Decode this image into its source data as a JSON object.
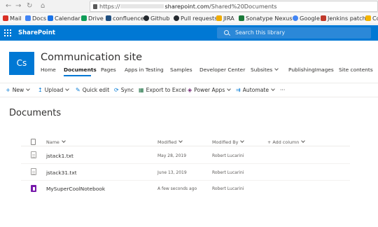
{
  "browser": {
    "url_prefix": "https://",
    "url_host": "sharepoint.com",
    "url_path": "/Shared%20Documents",
    "bookmarks": [
      {
        "label": "Mail",
        "icon": "mail-icon",
        "color": "#d93025"
      },
      {
        "label": "Docs",
        "icon": "docs-icon",
        "color": "#4285f4"
      },
      {
        "label": "Calendar",
        "icon": "calendar-icon",
        "color": "#1a73e8"
      },
      {
        "label": "Drive",
        "icon": "drive-icon",
        "color": "#0f9d58"
      },
      {
        "label": "confluence",
        "icon": "confluence-icon",
        "color": "#205081"
      },
      {
        "label": "Github",
        "icon": "github-icon",
        "color": "#24292e"
      },
      {
        "label": "Pull requests",
        "icon": "github-icon",
        "color": "#24292e"
      },
      {
        "label": "JIRA",
        "icon": "jira-icon",
        "color": "#f0ad00"
      },
      {
        "label": "Sonatype Nexus",
        "icon": "nexus-icon",
        "color": "#1b7a3a"
      },
      {
        "label": "Google",
        "icon": "google-icon",
        "color": "#4285f4"
      },
      {
        "label": "Jenkins patch",
        "icon": "jenkins-icon",
        "color": "#c0392b"
      },
      {
        "label": "Co",
        "icon": "bookmark-icon",
        "color": "#f4b400"
      }
    ]
  },
  "suite": {
    "app_name": "SharePoint",
    "search_placeholder": "Search this library",
    "accent": "#0078d4"
  },
  "site": {
    "logo_initials": "Cs",
    "title": "Communication site",
    "nav": [
      {
        "label": "Home"
      },
      {
        "label": "Documents"
      },
      {
        "label": "Pages"
      },
      {
        "label": "Apps in Testing"
      },
      {
        "label": "Samples"
      },
      {
        "label": "Developer Center"
      },
      {
        "label": "Subsites"
      },
      {
        "label": "PublishingImages"
      },
      {
        "label": "Site contents"
      }
    ]
  },
  "commands": [
    {
      "label": "New",
      "icon": "plus-icon"
    },
    {
      "label": "Upload",
      "icon": "upload-icon"
    },
    {
      "label": "Quick edit",
      "icon": "edit-icon"
    },
    {
      "label": "Sync",
      "icon": "sync-icon"
    },
    {
      "label": "Export to Excel",
      "icon": "excel-icon"
    },
    {
      "label": "Power Apps",
      "icon": "powerapps-icon"
    },
    {
      "label": "Automate",
      "icon": "automate-icon"
    },
    {
      "label": "···",
      "icon": "more-icon"
    }
  ],
  "page": {
    "title": "Documents"
  },
  "library": {
    "columns": {
      "name": "Name",
      "modified": "Modified",
      "modified_by": "Modified By",
      "add_column": "+ Add column"
    },
    "rows": [
      {
        "name": "jstack1.txt",
        "modified": "May 28, 2019",
        "modified_by": "Robert Lucarini",
        "icon": "text-file-icon"
      },
      {
        "name": "jstack31.txt",
        "modified": "June 13, 2019",
        "modified_by": "Robert Lucarini",
        "icon": "text-file-icon"
      },
      {
        "name": "MySuperCoolNotebook",
        "modified": "A few seconds ago",
        "modified_by": "Robert Lucarini",
        "icon": "onenote-icon"
      }
    ]
  }
}
